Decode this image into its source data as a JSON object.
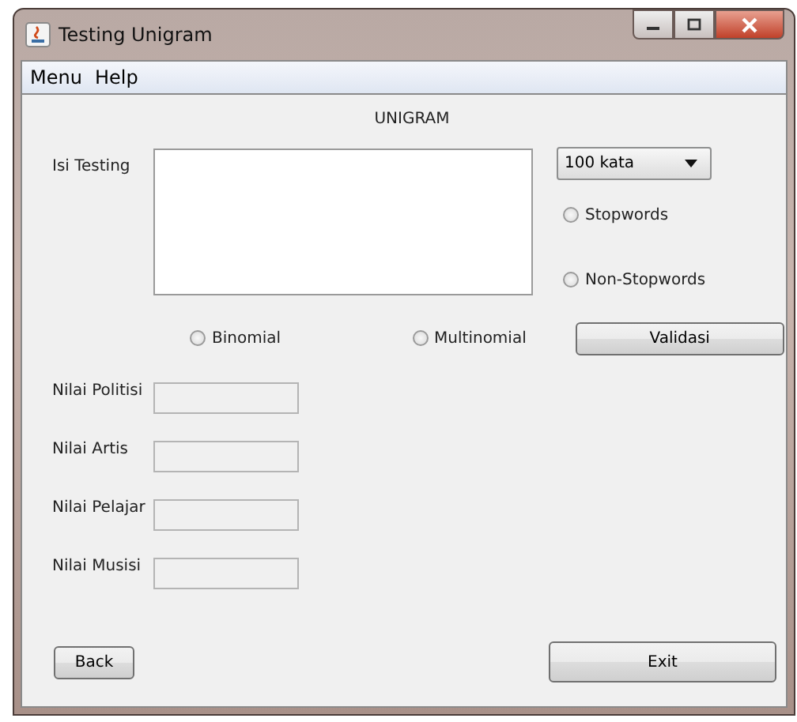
{
  "window": {
    "title": "Testing Unigram"
  },
  "menu": [
    "Menu",
    "Help"
  ],
  "heading": "UNIGRAM",
  "input": {
    "label": "Isi Testing"
  },
  "word_count": {
    "value": "100 kata"
  },
  "stopword_options": [
    {
      "label": "Stopwords",
      "selected": false
    },
    {
      "label": "Non-Stopwords",
      "selected": false
    }
  ],
  "model_options": [
    {
      "label": "Binomial",
      "selected": false
    },
    {
      "label": "Multinomial",
      "selected": false
    }
  ],
  "validate_button": "Validasi",
  "scores": [
    {
      "label": "Nilai Politisi"
    },
    {
      "label": "Nilai Artis"
    },
    {
      "label": "Nilai Pelajar"
    },
    {
      "label": "Nilai Musisi"
    }
  ],
  "buttons": {
    "back": "Back",
    "exit": "Exit"
  }
}
